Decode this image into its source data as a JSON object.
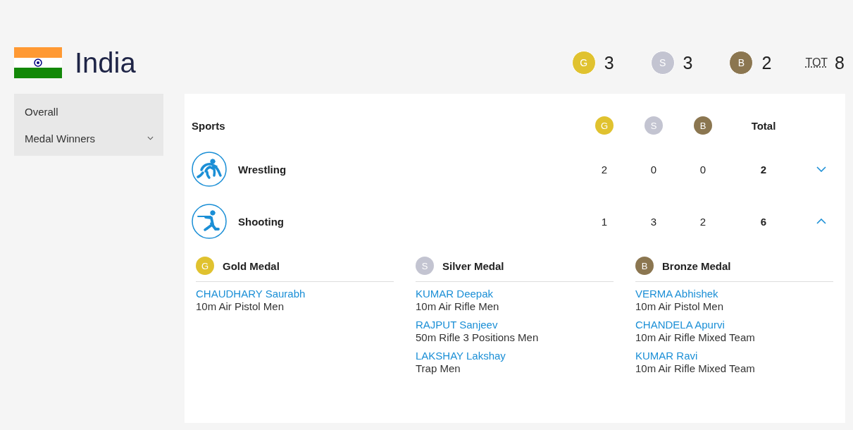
{
  "country": {
    "name": "India"
  },
  "medal_summary": [
    {
      "letter": "G",
      "color": "#e0c22f",
      "count": "3"
    },
    {
      "letter": "S",
      "color": "#c3c4d1",
      "count": "3"
    },
    {
      "letter": "B",
      "color": "#8b7650",
      "count": "2"
    }
  ],
  "total": {
    "label": "TOT",
    "count": "8"
  },
  "sidebar": {
    "items": [
      {
        "label": "Overall",
        "dropdown": false
      },
      {
        "label": "Medal Winners",
        "dropdown": true
      }
    ]
  },
  "table": {
    "columns": [
      {
        "label": "Sports",
        "kind": "text"
      },
      {
        "letter": "G",
        "color": "#e0c22f",
        "kind": "medal"
      },
      {
        "letter": "S",
        "color": "#c3c4d1",
        "kind": "medal"
      },
      {
        "letter": "B",
        "color": "#8b7650",
        "kind": "medal"
      },
      {
        "label": "Total",
        "kind": "text"
      }
    ],
    "rows": [
      {
        "sport": "Wrestling",
        "kind": "wrestling",
        "gold": "2",
        "silver": "0",
        "bronze": "0",
        "total": "2",
        "expanded": false
      },
      {
        "sport": "Shooting",
        "kind": "shooting",
        "gold": "1",
        "silver": "3",
        "bronze": "2",
        "total": "6",
        "expanded": true,
        "details": [
          {
            "letter": "G",
            "color": "#e0c22f",
            "title": "Gold Medal",
            "winners": [
              {
                "name": "CHAUDHARY Saurabh",
                "event": "10m Air Pistol Men"
              }
            ]
          },
          {
            "letter": "S",
            "color": "#c3c4d1",
            "title": "Silver Medal",
            "winners": [
              {
                "name": "KUMAR Deepak",
                "event": "10m Air Rifle Men"
              },
              {
                "name": "RAJPUT Sanjeev",
                "event": "50m Rifle 3 Positions Men"
              },
              {
                "name": "LAKSHAY Lakshay",
                "event": "Trap Men"
              }
            ]
          },
          {
            "letter": "B",
            "color": "#8b7650",
            "title": "Bronze Medal",
            "winners": [
              {
                "name": "VERMA Abhishek",
                "event": "10m Air Pistol Men"
              },
              {
                "name": "CHANDELA Apurvi",
                "event": "10m Air Rifle Mixed Team"
              },
              {
                "name": "KUMAR Ravi",
                "event": "10m Air Rifle Mixed Team"
              }
            ]
          }
        ]
      }
    ]
  }
}
